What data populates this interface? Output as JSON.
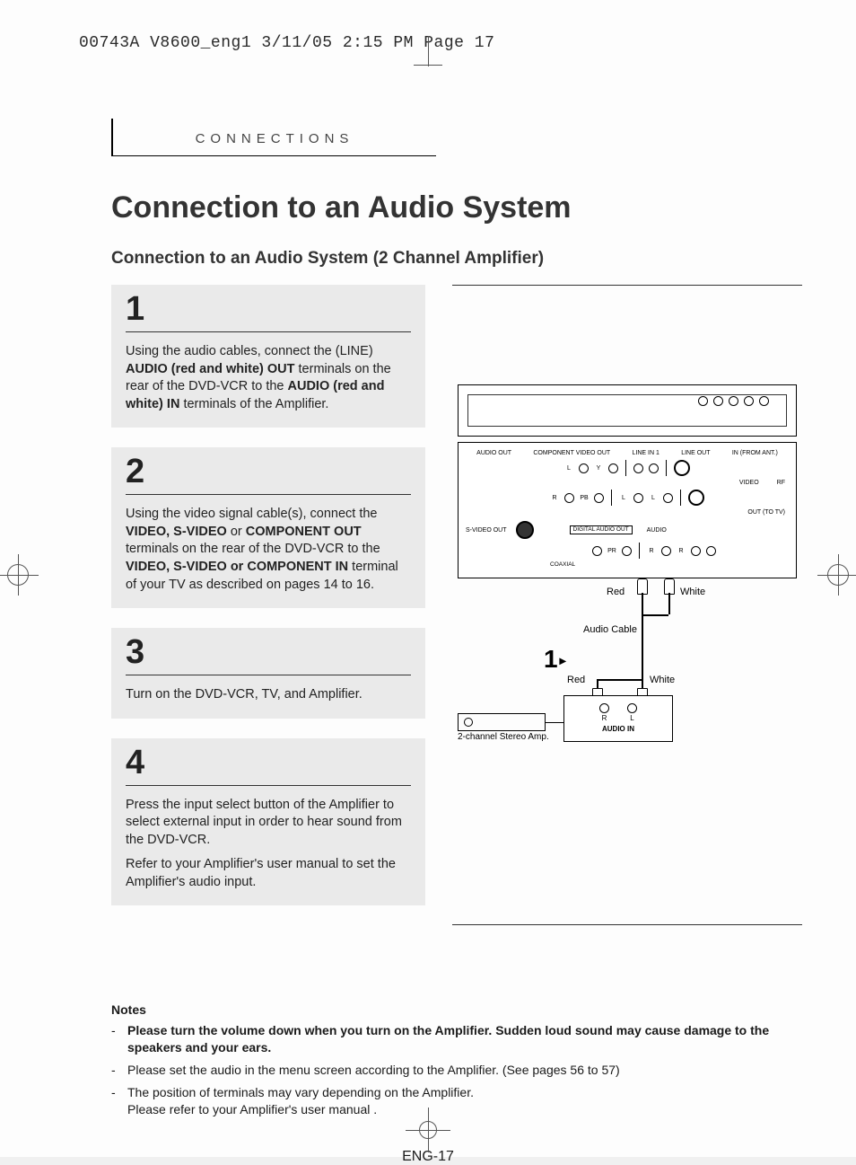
{
  "print_header": "00743A V8600_eng1  3/11/05  2:15 PM  Page 17",
  "section_tab": "CONNECTIONS",
  "title": "Connection to an Audio System",
  "subtitle": "Connection to an Audio System (2 Channel Amplifier)",
  "steps": [
    {
      "num": "1",
      "p": [
        "Using the audio cables, connect the (LINE) <b>AUDIO (red and white) OUT</b> terminals on the rear of the DVD-VCR to the <b>AUDIO (red and white) IN</b> terminals of the Amplifier."
      ]
    },
    {
      "num": "2",
      "p": [
        "Using the video signal cable(s), connect the <b>VIDEO, S-VIDEO</b> or <b>COMPONENT OUT</b> terminals on the rear of the DVD-VCR to the <b>VIDEO, S-VIDEO or COMPONENT IN</b> terminal of your TV as described on pages 14 to 16."
      ]
    },
    {
      "num": "3",
      "p": [
        "Turn on the DVD-VCR, TV, and Amplifier."
      ]
    },
    {
      "num": "4",
      "p": [
        "Press the input select button of the Amplifier to select external input in order to hear sound from the DVD-VCR.",
        "Refer to your Amplifier's user manual to set the Amplifier's audio input."
      ]
    }
  ],
  "diagram": {
    "labels_top": [
      "AUDIO OUT",
      "COMPONENT VIDEO OUT",
      "LINE IN 1",
      "LINE OUT"
    ],
    "row1_l": "L",
    "row1_y": "Y",
    "row2_r": "R",
    "row2_pb": "PB",
    "row2_l": "L",
    "row2_l2": "L",
    "label_video": "VIDEO",
    "label_in_ant": "IN (FROM ANT.)",
    "label_rf": "RF",
    "label_out_tv": "OUT (TO TV)",
    "svideo": "S-VIDEO OUT",
    "dao": "DIGITAL AUDIO OUT",
    "dao_sub": "COAXIAL",
    "audio": "AUDIO",
    "row3_pr": "PR",
    "row3_r": "R",
    "row3_r2": "R",
    "red": "Red",
    "white": "White",
    "cable": "Audio Cable",
    "step_marker": "1",
    "amp_r": "R",
    "amp_l": "L",
    "amp_in": "AUDIO IN",
    "amp_caption": "2-channel\nStereo Amp."
  },
  "notes_head": "Notes",
  "notes": [
    {
      "bold": true,
      "text": "Please turn the volume down when you turn on the Amplifier. Sudden loud sound may cause  damage to the speakers and your ears."
    },
    {
      "bold": false,
      "text": "Please set the audio in the menu screen according to the Amplifier. (See pages 56 to 57)"
    },
    {
      "bold": false,
      "text": "The position of terminals may vary depending on the Amplifier.\nPlease refer to your Amplifier's user manual ."
    }
  ],
  "page_num": "ENG-17"
}
